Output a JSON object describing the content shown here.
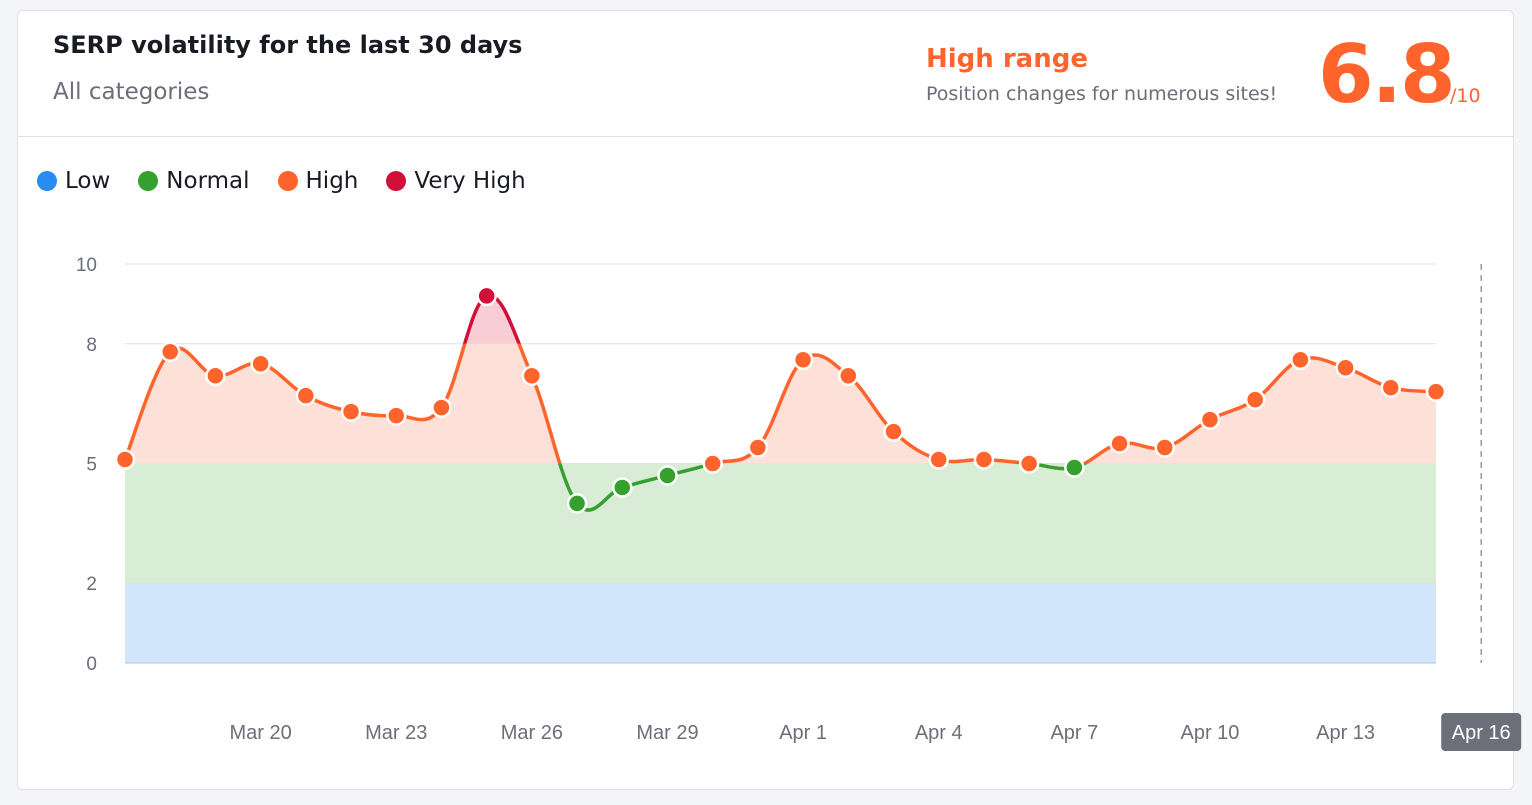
{
  "header": {
    "title": "SERP volatility for the last 30 days",
    "subtitle": "All categories",
    "range_label": "High range",
    "range_description": "Position changes for numerous sites!",
    "score": "6.8",
    "score_max": "/10"
  },
  "colors": {
    "low": "#2a8cf0",
    "normal": "#34a02e",
    "high": "#ff642d",
    "very_high": "#d0103a",
    "low_band": "#d2e6fb",
    "normal_band": "#d9ecd6",
    "high_band": "#fde0d7",
    "very_high_band": "#f8cdd3"
  },
  "legend": [
    {
      "label": "Low",
      "color": "#2a8cf0"
    },
    {
      "label": "Normal",
      "color": "#34a02e"
    },
    {
      "label": "High",
      "color": "#ff642d"
    },
    {
      "label": "Very High",
      "color": "#d0103a"
    }
  ],
  "chart_data": {
    "type": "area",
    "y_ticks": [
      "10",
      "8",
      "5",
      "2",
      "0"
    ],
    "y_tick_values": [
      10,
      8,
      5,
      2,
      0
    ],
    "ylim": [
      0,
      10
    ],
    "bands": [
      {
        "name": "Low",
        "from": 0,
        "to": 2
      },
      {
        "name": "Normal",
        "from": 2,
        "to": 5
      },
      {
        "name": "High",
        "from": 5,
        "to": 8
      },
      {
        "name": "Very High",
        "from": 8,
        "to": 10
      }
    ],
    "x": [
      "Mar 17",
      "Mar 18",
      "Mar 19",
      "Mar 20",
      "Mar 21",
      "Mar 22",
      "Mar 23",
      "Mar 24",
      "Mar 25",
      "Mar 26",
      "Mar 27",
      "Mar 28",
      "Mar 29",
      "Mar 30",
      "Mar 31",
      "Apr 1",
      "Apr 2",
      "Apr 3",
      "Apr 4",
      "Apr 5",
      "Apr 6",
      "Apr 7",
      "Apr 8",
      "Apr 9",
      "Apr 10",
      "Apr 11",
      "Apr 12",
      "Apr 13",
      "Apr 14",
      "Apr 15",
      "Apr 16"
    ],
    "x_tick_labels": [
      "Mar 20",
      "Mar 23",
      "Mar 26",
      "Mar 29",
      "Apr 1",
      "Apr 4",
      "Apr 7",
      "Apr 10",
      "Apr 13",
      "Apr 16"
    ],
    "selected_x": "Apr 16",
    "values": [
      5.1,
      7.8,
      7.2,
      7.5,
      6.7,
      6.3,
      6.2,
      6.4,
      9.2,
      7.2,
      4.0,
      4.4,
      4.7,
      5.0,
      5.4,
      7.6,
      7.2,
      5.8,
      5.1,
      5.1,
      5.0,
      4.9,
      5.5,
      5.4,
      6.1,
      6.6,
      7.6,
      7.4,
      6.9,
      6.8
    ],
    "xlabel": "",
    "ylabel": "",
    "grid": true,
    "legend_position": "top-left"
  }
}
